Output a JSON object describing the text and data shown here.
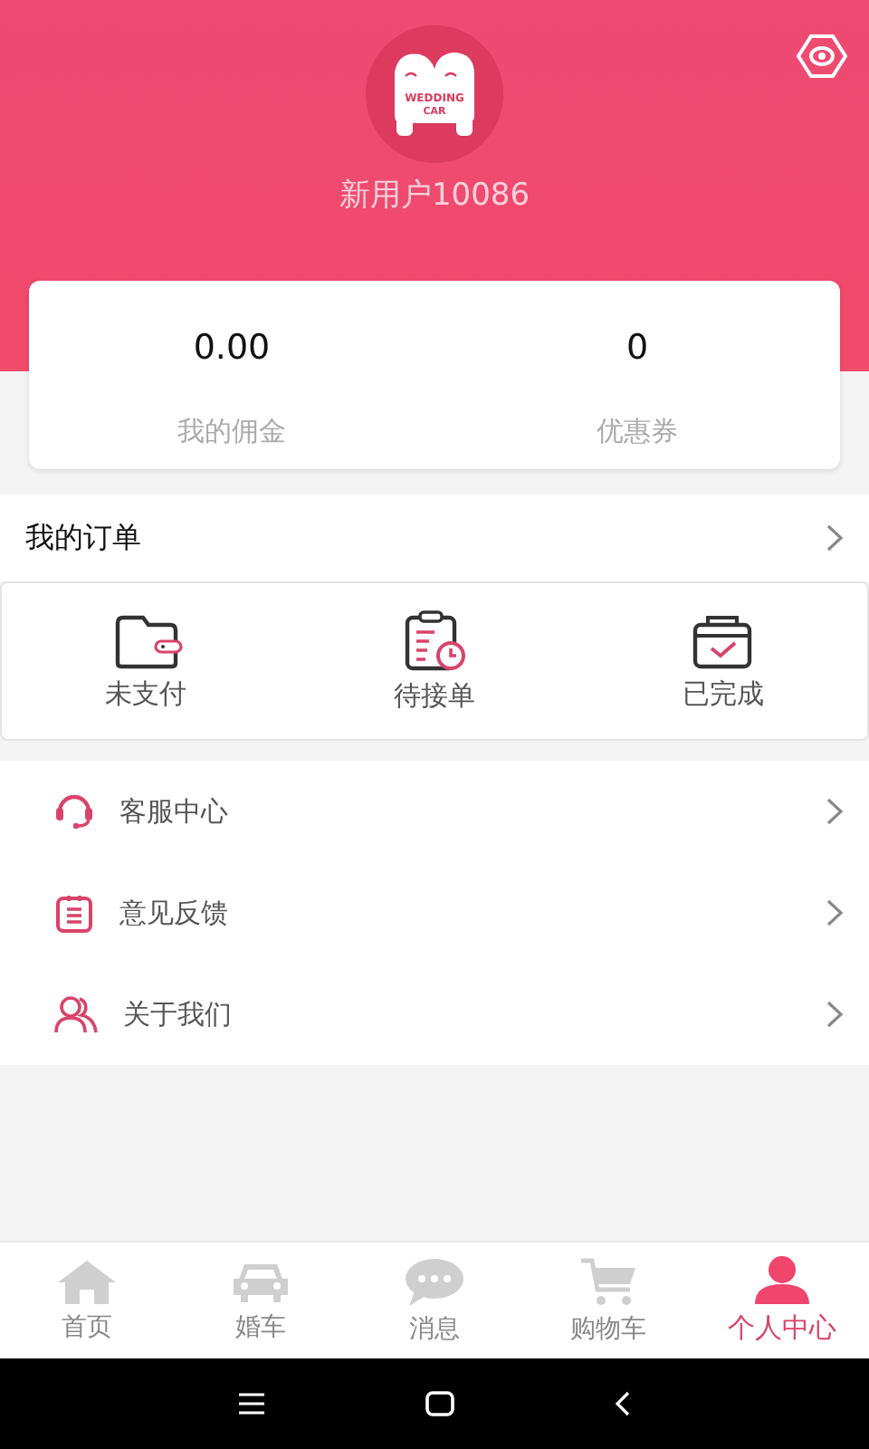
{
  "header": {
    "logo": {
      "lines": [
        "WEDDING",
        "CAR"
      ]
    },
    "username": "新用户10086"
  },
  "stats": [
    {
      "value": "0.00",
      "label": "我的佣金"
    },
    {
      "value": "0",
      "label": "优惠券"
    }
  ],
  "orders": {
    "title": "我的订单",
    "items": [
      {
        "kind": "wallet",
        "label": "未支付"
      },
      {
        "kind": "pending",
        "label": "待接单"
      },
      {
        "kind": "done",
        "label": "已完成"
      }
    ]
  },
  "menu": [
    {
      "kind": "service",
      "label": "客服中心"
    },
    {
      "kind": "feedback",
      "label": "意见反馈"
    },
    {
      "kind": "about",
      "label": "关于我们"
    }
  ],
  "tabs": [
    {
      "kind": "home",
      "label": "首页",
      "selected": false
    },
    {
      "kind": "car",
      "label": "婚车",
      "selected": false
    },
    {
      "kind": "message",
      "label": "消息",
      "selected": false
    },
    {
      "kind": "cart",
      "label": "购物车",
      "selected": false
    },
    {
      "kind": "profile",
      "label": "个人中心",
      "selected": true
    }
  ]
}
